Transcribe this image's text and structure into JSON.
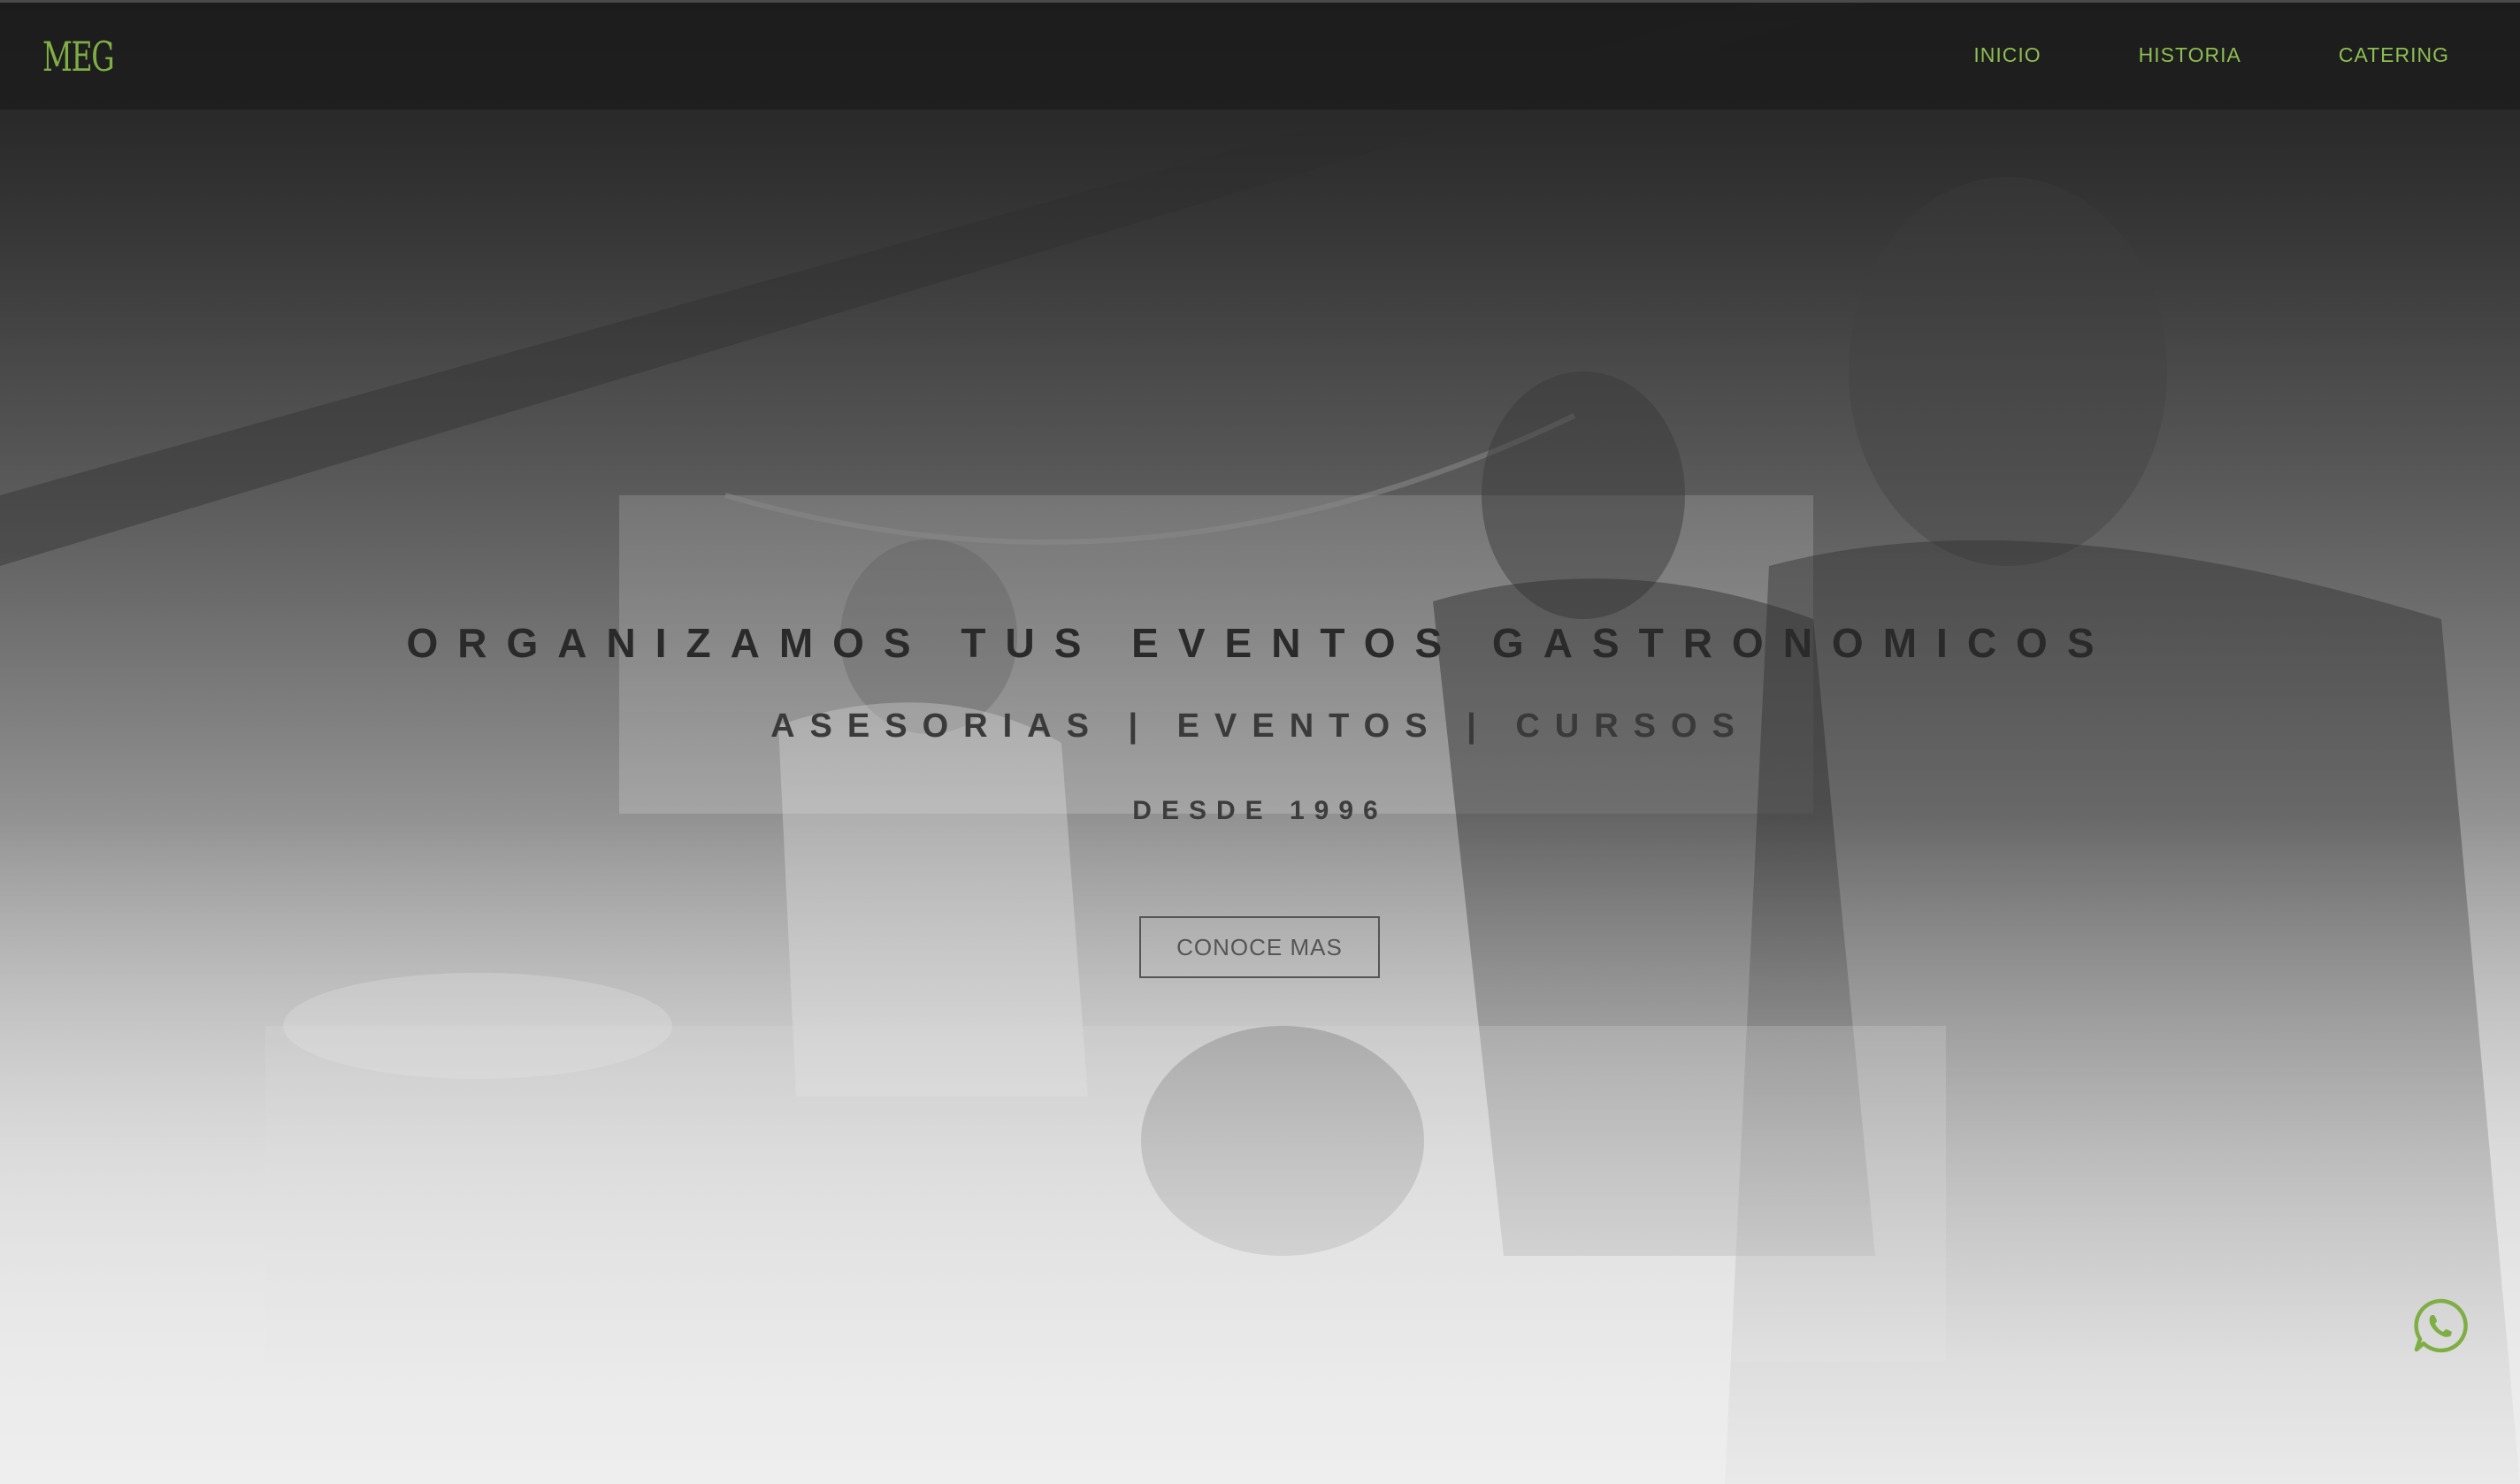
{
  "header": {
    "logo_text": "MEG",
    "nav": [
      {
        "label": "INICIO"
      },
      {
        "label": "HISTORIA"
      },
      {
        "label": "CATERING"
      }
    ],
    "accent_color": "#8dbf52"
  },
  "hero": {
    "title": "ORGANIZAMOS TUS EVENTOS GASTRONOMICOS",
    "subtitle": "ASESORIAS | EVENTOS | CURSOS",
    "since": "DESDE 1996",
    "cta_label": "CONOCE MAS",
    "background": "grayscale-catering-photo"
  },
  "floating": {
    "whatsapp_icon": "whatsapp-icon",
    "color": "#7fae45"
  }
}
